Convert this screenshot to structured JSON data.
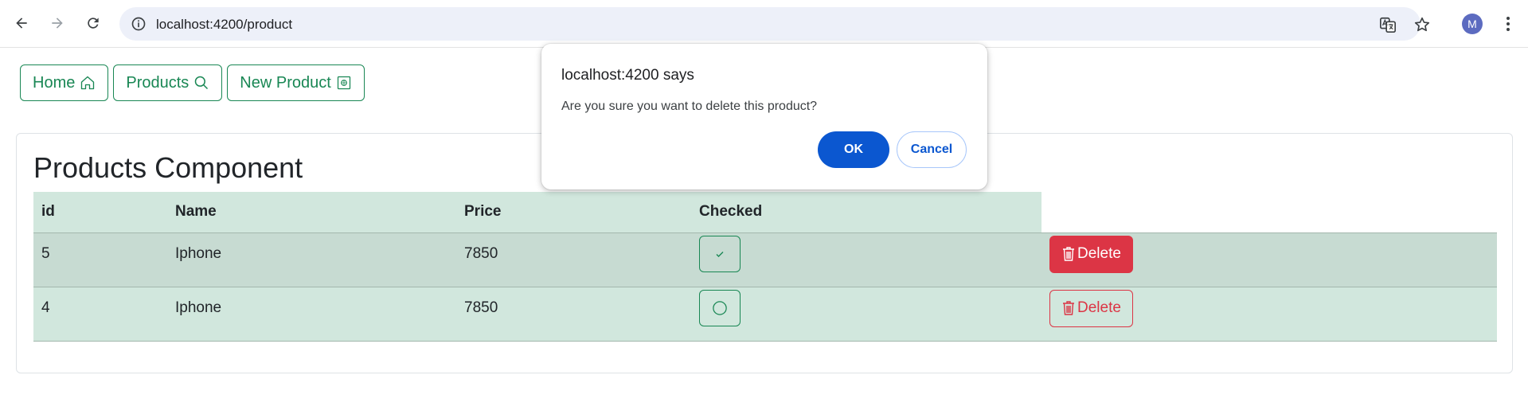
{
  "browser": {
    "url": "localhost:4200/product",
    "avatar_letter": "M",
    "icons": [
      "back-arrow-icon",
      "forward-arrow-icon",
      "reload-icon",
      "site-info-icon",
      "translate-icon",
      "bookmark-star-icon",
      "kebab-menu-icon"
    ]
  },
  "nav": {
    "home_label": "Home",
    "products_label": "Products",
    "new_product_label": "New Product"
  },
  "page": {
    "title": "Products Component"
  },
  "table": {
    "headers": [
      "id",
      "Name",
      "Price",
      "Checked"
    ],
    "rows": [
      {
        "id": "5",
        "name": "Iphone",
        "price": "7850",
        "checked": true,
        "delete_label": "Delete",
        "delete_style": "filled"
      },
      {
        "id": "4",
        "name": "Iphone",
        "price": "7850",
        "checked": false,
        "delete_label": "Delete",
        "delete_style": "outline"
      }
    ]
  },
  "dialog": {
    "title": "localhost:4200 says",
    "message": "Are you sure you want to delete this product?",
    "ok_label": "OK",
    "cancel_label": "Cancel"
  },
  "colors": {
    "success": "#198754",
    "danger": "#dc3545",
    "table_bg": "#d1e7dd",
    "dialog_primary": "#0b57d0"
  }
}
